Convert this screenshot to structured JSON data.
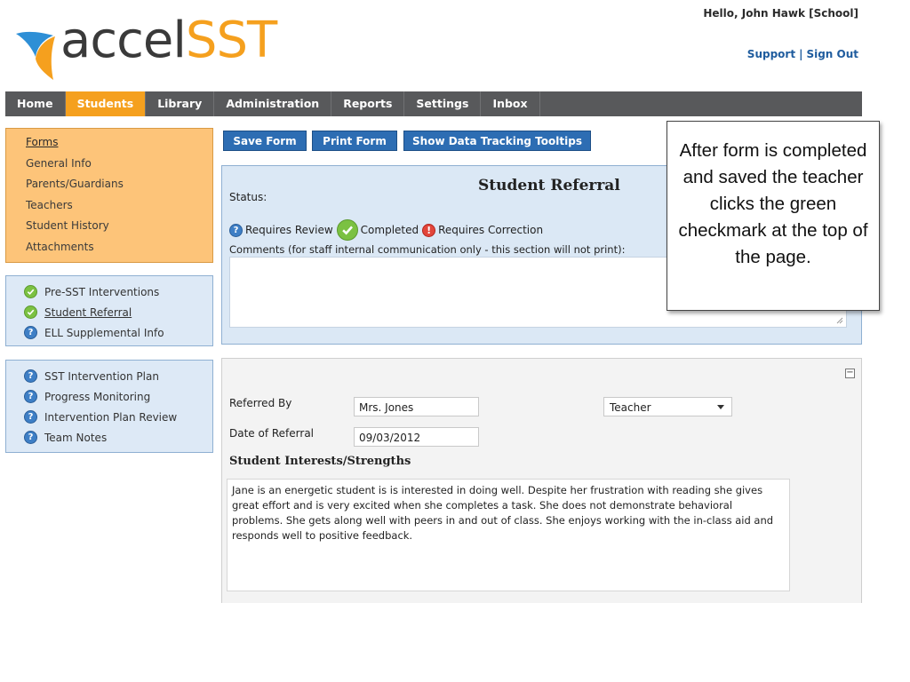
{
  "header": {
    "logo_part1": "accel",
    "logo_part2": "SST",
    "greeting": "Hello, John Hawk [School]",
    "support_label": "Support",
    "separator": "|",
    "signout_label": "Sign Out"
  },
  "nav": {
    "items": [
      {
        "label": "Home",
        "active": false
      },
      {
        "label": "Students",
        "active": true
      },
      {
        "label": "Library",
        "active": false
      },
      {
        "label": "Administration",
        "active": false
      },
      {
        "label": "Reports",
        "active": false
      },
      {
        "label": "Settings",
        "active": false
      },
      {
        "label": "Inbox",
        "active": false
      }
    ]
  },
  "sidebar": {
    "student_links": [
      "Forms",
      "General Info",
      "Parents/Guardians",
      "Teachers",
      "Student History",
      "Attachments"
    ],
    "sst_forms": [
      {
        "label": "Pre-SST Interventions",
        "icon": "check-circle-icon"
      },
      {
        "label": "Student Referral",
        "icon": "check-circle-icon"
      },
      {
        "label": "ELL Supplemental Info",
        "icon": "question-circle-icon"
      }
    ],
    "plan_forms": [
      {
        "label": "SST Intervention Plan",
        "icon": "question-circle-icon"
      },
      {
        "label": "Progress Monitoring",
        "icon": "question-circle-icon"
      },
      {
        "label": "Intervention Plan Review",
        "icon": "question-circle-icon"
      },
      {
        "label": "Team Notes",
        "icon": "question-circle-icon"
      }
    ]
  },
  "toolbar": {
    "save_label": "Save Form",
    "print_label": "Print Form",
    "tooltips_label": "Show Data Tracking Tooltips"
  },
  "status": {
    "title": "Student Referral",
    "status_label": "Status:",
    "requires_review": "Requires Review",
    "completed": "Completed",
    "requires_correction": "Requires Correction",
    "comments_label": "Comments (for staff internal communication only - this section will not print):"
  },
  "callout": {
    "text": "After form is completed and saved the teacher clicks the green checkmark at the top of the page."
  },
  "form": {
    "referred_by_label": "Referred By",
    "referred_by_value": "Mrs. Jones",
    "role_value": "Teacher",
    "date_label": "Date of Referral",
    "date_value": "09/03/2012",
    "interests_heading": "Student Interests/Strengths",
    "interests_text": "Jane is an energetic student is is interested in doing well.  Despite her frustration with reading she gives great effort and is very excited when she completes a task.  She does not demonstrate behavioral problems.  She gets along well with peers in and out of class.  She enjoys working with the in-class aid and responds well to positive feedback."
  },
  "colors": {
    "accent_orange": "#f5a01e",
    "nav_gray": "#58595b",
    "button_blue": "#2d6db3",
    "panel_blue": "#dbe8f5"
  }
}
